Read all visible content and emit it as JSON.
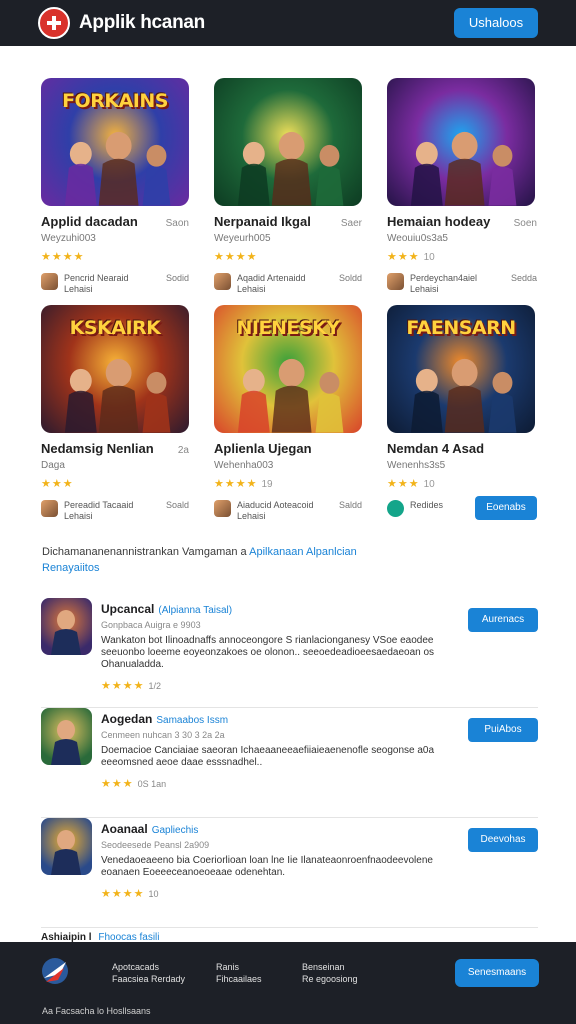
{
  "header": {
    "title": "Applik hcanan",
    "button": "Ushaloos"
  },
  "cards": [
    {
      "banner": "FORKAINS",
      "title": "Applid dacadan",
      "size": "Saon",
      "sub": "Weyzuhi003",
      "stars": "★★★★",
      "rating": "",
      "dev_name": "Pencrid Nearaid",
      "dev_sub": "Lehaisi",
      "dev_count": "Sodid",
      "art_a": "#2f3fa8",
      "art_b": "#f3b23e",
      "art_c": "#6a2aa0"
    },
    {
      "banner": "",
      "title": "Nerpanaid Ikgal",
      "size": "Saer",
      "sub": "Weyeurh005",
      "stars": "★★★★",
      "rating": "",
      "dev_name": "Aqadid Artenaidd",
      "dev_sub": "Lehaisi",
      "dev_count": "Soldd",
      "art_a": "#1e6a3a",
      "art_b": "#f0e05a",
      "art_c": "#0d3b22"
    },
    {
      "banner": "",
      "title": "Hemaian hodeay",
      "size": "Soen",
      "sub": "Weouiu0s3a5",
      "stars": "★★★",
      "rating": "10",
      "dev_name": "Perdeychan4aiel",
      "dev_sub": "Lehaisi",
      "dev_count": "Sedda",
      "art_a": "#7a2ca0",
      "art_b": "#1da6f0",
      "art_c": "#231345"
    },
    {
      "banner": "KSKAIRK",
      "title": "Nedamsig Nenlian",
      "size": "2a",
      "sub": "Daga",
      "stars": "★★★",
      "rating": "",
      "dev_name": "Pereadid Tacaaid",
      "dev_sub": "Lehaisi",
      "dev_count": "Soald",
      "art_a": "#a0331a",
      "art_b": "#f7b237",
      "art_c": "#2b1a2e"
    },
    {
      "banner": "NIENESKY",
      "title": "Aplienla Ujegan",
      "size": "",
      "sub": "Wehenha003",
      "stars": "★★★★",
      "rating": "19",
      "dev_name": "Aiaducid Aoteacoid",
      "dev_sub": "Lehaisi",
      "dev_count": "Saldd",
      "art_a": "#e0c23a",
      "art_b": "#3aa03a",
      "art_c": "#d8432a"
    },
    {
      "banner": "FAENSARN",
      "title": "Nemdan 4 Asad",
      "size": "",
      "sub": "Wenenhs3s5",
      "stars": "★★★",
      "rating": "10",
      "dev_name": "Redides",
      "dev_sub": "",
      "dev_count": "",
      "art_a": "#1b3a6e",
      "art_b": "#f08a2a",
      "art_c": "#0d1b33"
    }
  ],
  "card_button": "Eoenabs",
  "intro": {
    "text": "Dichamananenannistrankan Vamgaman a",
    "link": "Apilkanaan Alpanlcian",
    "line2": "Renayaiitos"
  },
  "list": [
    {
      "title": "Upcancal",
      "category": "(Alpianna Taisal)",
      "meta": "Gonpbaca Auigra e 9903",
      "desc": "Wankaton bot Ilinoadnaffs annoceongore S rianlacionganesy VSoe eaodee seeuonbo loeeme eoyeonzakoes oe olonon.. seeoedeadioeesaedaeoan os Ohanualadda.",
      "stars": "★★★★",
      "rating": "1/2",
      "button": "Aurenacs"
    },
    {
      "title": "Aogedan",
      "category": "Samaabos Issm",
      "meta": "Cenmeen nuhcan 3 30 3 2a 2a",
      "desc": "Doemacioe Canciaiae saeoran Ichaeaaneeaefiiaieaenenofle seogonse a0a eeeomsned aeoe daae esssnadhel..",
      "stars": "★★★",
      "rating": "0S 1an",
      "button": "PuiAbos"
    },
    {
      "title": "Aoanaal",
      "category": "Gapliechis",
      "meta": "Seodeesede Peansl 2a909",
      "desc": "Venedaoeaeeno bia Coeriorlioan loan lne Iie Ilanateaonroenfnaodeevolene eoanaen Eoeeeceanoeoeaae odenehtan.",
      "stars": "★★★★",
      "rating": "10",
      "button": "Deevohas"
    }
  ],
  "list_partial": {
    "title": "Ashiaipin l",
    "category": "Fhoocas fasili"
  },
  "footer": {
    "col1": [
      "Apotcacads",
      "Faacsiea Rerdady"
    ],
    "col2": [
      "Ranis",
      "Fihcaailaes"
    ],
    "col3": [
      "Benseinan",
      "Re egoosiong"
    ],
    "button": "Senesmaans",
    "copyright": "Aa Facsacha lo Hosllsaans"
  }
}
